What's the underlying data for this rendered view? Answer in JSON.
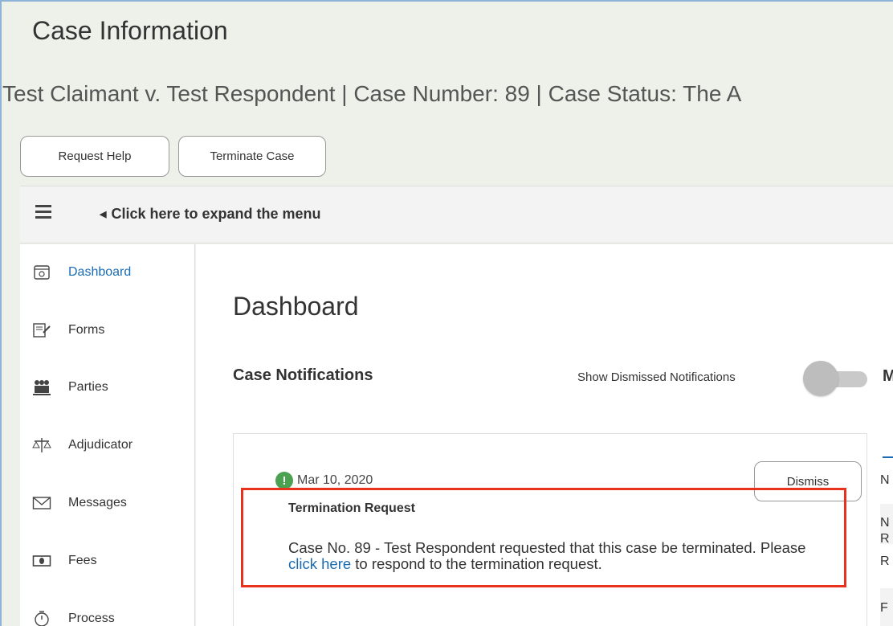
{
  "header": {
    "title": "Case Information",
    "subtitle": "Test Claimant v. Test Respondent | Case Number: 89 | Case Status:  The A"
  },
  "actions": {
    "request_help": "Request Help",
    "terminate_case": "Terminate Case"
  },
  "menu_bar": {
    "expand_label": "Click here to expand the menu"
  },
  "sidebar": {
    "items": [
      {
        "label": "Dashboard",
        "icon": "dashboard-icon",
        "active": true
      },
      {
        "label": "Forms",
        "icon": "forms-icon"
      },
      {
        "label": "Parties",
        "icon": "parties-icon"
      },
      {
        "label": "Adjudicator",
        "icon": "scales-icon"
      },
      {
        "label": "Messages",
        "icon": "envelope-icon"
      },
      {
        "label": "Fees",
        "icon": "money-icon"
      },
      {
        "label": "Process",
        "icon": "timer-icon"
      }
    ]
  },
  "main": {
    "title": "Dashboard",
    "notifications_title": "Case Notifications",
    "show_dismissed_label": "Show Dismissed Notifications",
    "show_dismissed_on": false,
    "right_panel_title_cut": "M",
    "notification": {
      "date": "Mar 10, 2020",
      "dismiss_label": "Dismiss",
      "title": "Termination Request",
      "body_before": "Case No. 89 - Test Respondent requested that this case be terminated. Please ",
      "link_text": "click here",
      "body_after": " to respond to the termination request."
    },
    "right_column_cut": [
      "N",
      "N\nR",
      "R",
      "F"
    ]
  },
  "colors": {
    "accent": "#1a6bb3",
    "highlight_border": "#e8321e",
    "notice_green": "#4aa150"
  }
}
